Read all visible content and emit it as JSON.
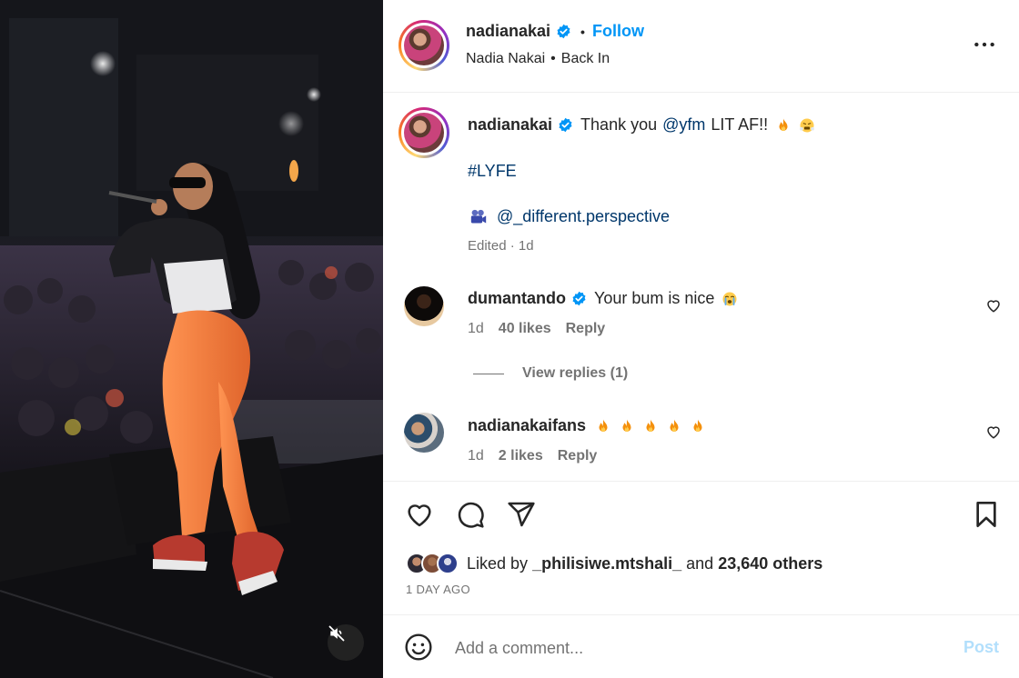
{
  "post": {
    "username": "nadianakai",
    "follow_label": "Follow",
    "separator": "•",
    "location_owner": "Nadia Nakai",
    "location_song": "Back In",
    "more_icon": "more-horizontal-icon"
  },
  "caption": {
    "username": "nadianakai",
    "text_before": "Thank you",
    "mention": "@yfm",
    "text_after": "LIT AF!!",
    "hashtag": "#LYFE",
    "credit": "@_different.perspective",
    "meta": "Edited · 1d"
  },
  "comments": [
    {
      "username": "dumantando",
      "verified": true,
      "text": "Your bum is nice",
      "time": "1d",
      "likes": "40 likes",
      "reply": "Reply"
    },
    {
      "username": "nadianakaifans",
      "verified": false,
      "text": "",
      "time": "1d",
      "likes": "2 likes",
      "reply": "Reply"
    }
  ],
  "view_replies": "View replies (1)",
  "likes": {
    "prefix": "Liked by",
    "user": "_philisiwe.mtshali_",
    "middle": "and",
    "count": "23,640 others"
  },
  "date": "1 DAY AGO",
  "comment_box": {
    "placeholder": "Add a comment...",
    "post_label": "Post"
  },
  "colors": {
    "accent": "#0095f6",
    "link": "#00376b",
    "muted": "#737373",
    "post_disabled": "#b2dffc"
  }
}
